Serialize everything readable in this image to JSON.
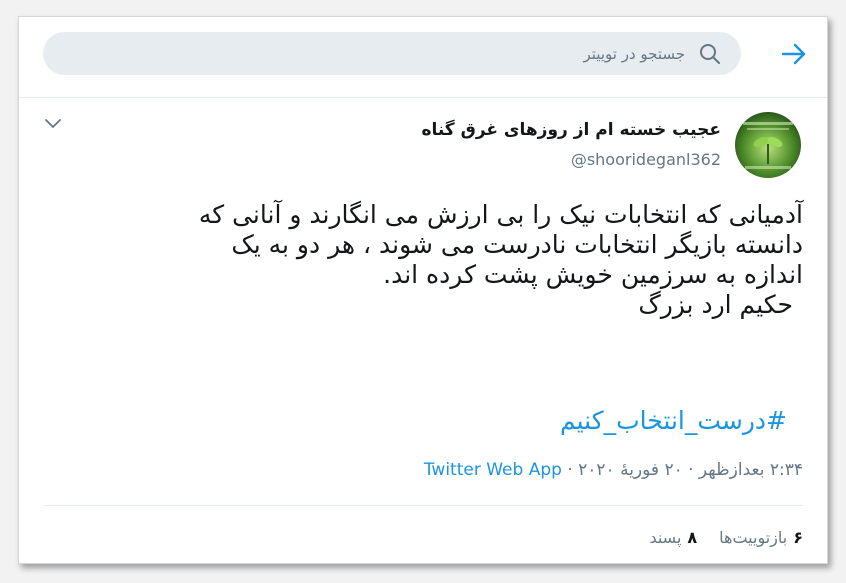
{
  "search": {
    "placeholder": "جستجو در توییتر"
  },
  "tweet": {
    "display_name": "عجیب خسته ام از روزهای غرق گناه",
    "handle": "@shoorideganl362",
    "text_lines": [
      "آدمیانی که انتخابات نیک را بی ارزش می انگارند و آنانی که",
      "دانسته بازیگر انتخابات نادرست می شوند ، هر دو به یک",
      "اندازه به سرزمین خویش  پشت کرده اند.",
      "حکیم ارد بزرگ"
    ],
    "hashtag": "#درست_انتخاب_کنیم",
    "timestamp": "۲:۳۴ بعدازظهر · ۲۰ فوریهٔ ۲۰۲۰ · ",
    "source_app": "Twitter Web App",
    "retweets": {
      "count": "۶",
      "label": "بازتوییت‌ها"
    },
    "likes": {
      "count": "۸",
      "label": "پسند"
    }
  },
  "colors": {
    "accent": "#1b95e0",
    "muted": "#657786",
    "border": "#e6ecf0"
  },
  "icons": [
    "back-arrow-icon",
    "search-icon",
    "chevron-down-icon"
  ]
}
